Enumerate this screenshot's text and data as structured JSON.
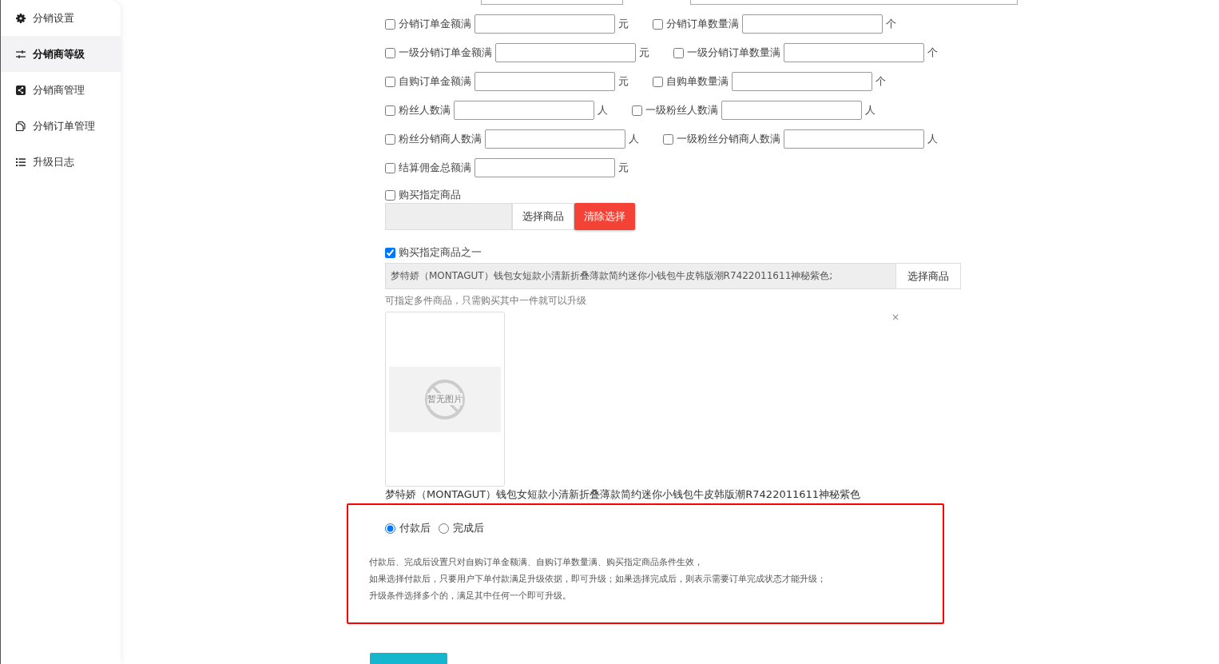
{
  "sidebar": {
    "items": [
      {
        "label": "分销设置",
        "selected": false
      },
      {
        "label": "分销商等级",
        "selected": true
      },
      {
        "label": "分销商管理",
        "selected": false
      },
      {
        "label": "分销订单管理",
        "selected": false
      },
      {
        "label": "升级日志",
        "selected": false
      }
    ]
  },
  "conditions": [
    [
      {
        "label": "分销订单金额满",
        "checked": false,
        "unit": "元"
      },
      {
        "label": "分销订单数量满",
        "checked": false,
        "unit": "个"
      }
    ],
    [
      {
        "label": "一级分销订单金额满",
        "checked": false,
        "unit": "元"
      },
      {
        "label": "一级分销订单数量满",
        "checked": false,
        "unit": "个"
      }
    ],
    [
      {
        "label": "自购订单金额满",
        "checked": false,
        "unit": "元"
      },
      {
        "label": "自购单数量满",
        "checked": false,
        "unit": "个"
      }
    ],
    [
      {
        "label": "粉丝人数满",
        "checked": false,
        "unit": "人"
      },
      {
        "label": "一级粉丝人数满",
        "checked": false,
        "unit": "人"
      }
    ],
    [
      {
        "label": "粉丝分销商人数满",
        "checked": false,
        "unit": "人"
      },
      {
        "label": "一级粉丝分销商人数满",
        "checked": false,
        "unit": "人"
      }
    ],
    [
      {
        "label": "结算佣金总额满",
        "checked": false,
        "unit": "元"
      }
    ]
  ],
  "specific_goods": {
    "label": "购买指定商品",
    "checked": false,
    "select_button": "选择商品",
    "clear_button": "清除选择"
  },
  "one_of_goods": {
    "label": "购买指定商品之一",
    "checked": true,
    "value": "梦特娇（MONTAGUT）钱包女短款小清新折叠薄款简约迷你小钱包牛皮韩版潮R7422011611神秘紫色;",
    "select_button": "选择商品",
    "hint": "可指定多件商品，只需购买其中一件就可以升级",
    "image_text": "暂无图片",
    "remove": "×",
    "product_name": "梦特娇（MONTAGUT）钱包女短款小清新折叠薄款简约迷你小钱包牛皮韩版潮R7422011611神秘紫色"
  },
  "timing": {
    "options": [
      {
        "label": "付款后",
        "selected": true
      },
      {
        "label": "完成后",
        "selected": false
      }
    ],
    "notes": [
      "付款后、完成后设置只对自购订单金额满、自购订单数量满、购买指定商品条件生效，",
      "如果选择付款后，只要用户下单付款满足升级依据，即可升级；如果选择完成后，则表示需要订单完成状态才能升级；",
      "升级条件选择多个的，满足其中任何一个即可升级。"
    ]
  }
}
